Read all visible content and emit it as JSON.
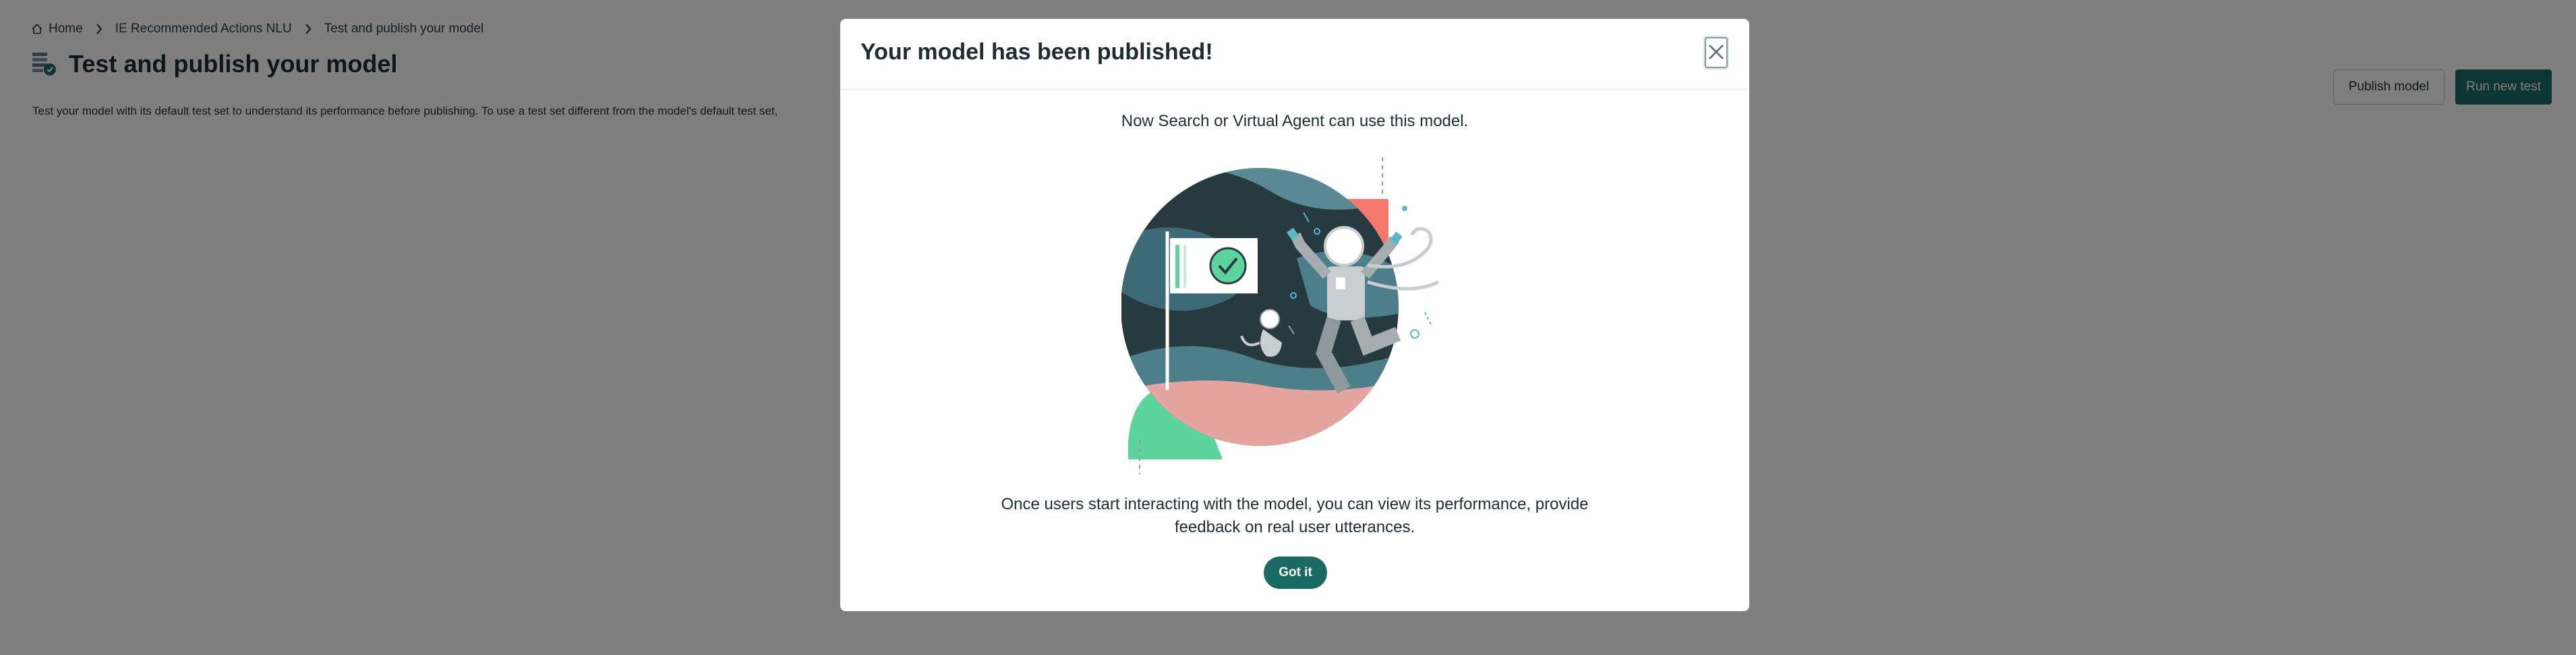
{
  "breadcrumb": {
    "home": "Home",
    "section": "IE Recommended Actions NLU",
    "current": "Test and publish your model"
  },
  "page": {
    "title": "Test and publish your model",
    "description": "Test your model with its default test set to understand its performance before publishing. To use a test set different from the model's default test set,"
  },
  "actions": {
    "publish": "Publish model",
    "run_test": "Run new test"
  },
  "modal": {
    "title": "Your model has been published!",
    "subtitle": "Now Search or Virtual Agent can use this model.",
    "body": "Once users start interacting with the model, you can view its performance, provide feedback on real user utterances.",
    "confirm": "Got it"
  },
  "colors": {
    "primary": "#1c6b63",
    "overlay": "rgba(0,0,0,0.5)"
  },
  "icons": [
    "home-icon",
    "chevron-right-icon",
    "model-test-icon",
    "close-icon"
  ]
}
